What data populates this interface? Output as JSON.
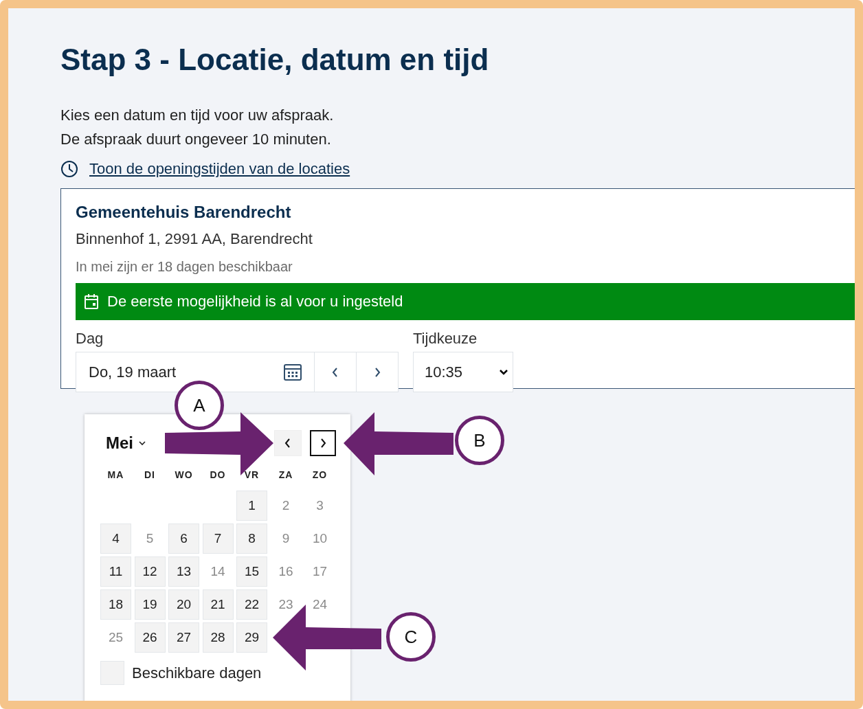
{
  "heading": "Stap 3 - Locatie, datum en tijd",
  "intro": [
    "Kies een datum en tijd voor uw afspraak.",
    "De afspraak duurt ongeveer 10 minuten."
  ],
  "opening_hours_link": "Toon de openingstijden van de locaties",
  "location": {
    "name": "Gemeentehuis Barendrecht",
    "address": "Binnenhof 1, 2991 AA, Barendrecht",
    "availability": "In mei zijn er 18 dagen beschikbaar",
    "notice": "De eerste mogelijkheid is al voor u ingesteld"
  },
  "day_field": {
    "label": "Dag",
    "value": "Do, 19 maart"
  },
  "time_field": {
    "label": "Tijdkeuze",
    "value": "10:35"
  },
  "calendar": {
    "month": "Mei",
    "prev_button": {
      "focused": false
    },
    "next_button": {
      "focused": true
    },
    "weekdays": [
      "MA",
      "DI",
      "WO",
      "DO",
      "VR",
      "ZA",
      "ZO"
    ],
    "weeks": [
      [
        {
          "label": "1",
          "available": true
        },
        {
          "label": "2",
          "available": false
        },
        {
          "label": "3",
          "available": false
        }
      ],
      [
        {
          "label": "4",
          "available": true
        },
        {
          "label": "5",
          "available": false
        },
        {
          "label": "6",
          "available": true
        },
        {
          "label": "7",
          "available": true
        },
        {
          "label": "8",
          "available": true
        },
        {
          "label": "9",
          "available": false
        },
        {
          "label": "10",
          "available": false
        }
      ],
      [
        {
          "label": "11",
          "available": true
        },
        {
          "label": "12",
          "available": true
        },
        {
          "label": "13",
          "available": true
        },
        {
          "label": "14",
          "available": false
        },
        {
          "label": "15",
          "available": true
        },
        {
          "label": "16",
          "available": false
        },
        {
          "label": "17",
          "available": false
        }
      ],
      [
        {
          "label": "18",
          "available": true
        },
        {
          "label": "19",
          "available": true
        },
        {
          "label": "20",
          "available": true
        },
        {
          "label": "21",
          "available": true
        },
        {
          "label": "22",
          "available": true
        },
        {
          "label": "23",
          "available": false
        },
        {
          "label": "24",
          "available": false
        }
      ],
      [
        {
          "label": "25",
          "available": false
        },
        {
          "label": "26",
          "available": true
        },
        {
          "label": "27",
          "available": true
        },
        {
          "label": "28",
          "available": true
        },
        {
          "label": "29",
          "available": true
        }
      ]
    ],
    "legend": "Beschikbare dagen"
  },
  "annotations": [
    {
      "label": "A"
    },
    {
      "label": "B"
    },
    {
      "label": "C"
    }
  ]
}
